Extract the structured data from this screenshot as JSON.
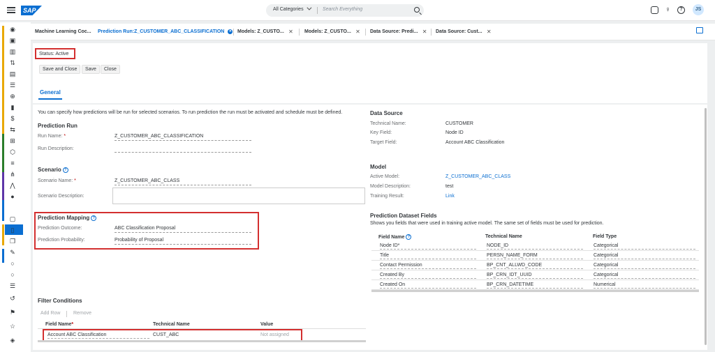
{
  "shell": {
    "search_category": "All Categories",
    "search_placeholder": "Search Everything",
    "avatar": "JS",
    "logo": "SAP"
  },
  "tabs": [
    {
      "label": "Machine Learning Coc..."
    },
    {
      "label": "Prediction Run:Z_CUSTOMER_ABC_CLASSIFICATION"
    },
    {
      "label": "Models: Z_CUSTO..."
    },
    {
      "label": "Models: Z_CUSTO..."
    },
    {
      "label": "Data Source: Predi..."
    },
    {
      "label": "Data Source: Cust..."
    }
  ],
  "header": {
    "status_label": "Status:",
    "status_value": "Active",
    "save_close": "Save and Close",
    "save": "Save",
    "close": "Close",
    "tab_general": "General"
  },
  "intro": "You can specify how predictions will be run for selected scenarios. To run prediction the run must be activated and schedule must be defined.",
  "prediction_run": {
    "title": "Prediction Run",
    "run_name_label": "Run Name:",
    "run_name": "Z_CUSTOMER_ABC_CLASSIFICATION",
    "run_desc_label": "Run Description:"
  },
  "scenario": {
    "title": "Scenario",
    "name_label": "Scenario Name:",
    "name": "Z_CUSTOMER_ABC_CLASS",
    "desc_label": "Scenario Description:"
  },
  "mapping": {
    "title": "Prediction Mapping",
    "outcome_label": "Prediction Outcome:",
    "outcome": "ABC Classification Proposal",
    "prob_label": "Prediction Probability:",
    "prob": "Probability of Proposal"
  },
  "filter": {
    "title": "Filter Conditions",
    "add_row": "Add Row",
    "remove": "Remove",
    "col_field": "Field Name",
    "col_tech": "Technical Name",
    "col_value": "Value",
    "row_field": "Account ABC Classification",
    "row_tech": "CUST_ABC",
    "row_value": "Not assigned"
  },
  "data_source": {
    "title": "Data Source",
    "tech_label": "Technical Name:",
    "tech": "CUSTOMER",
    "key_label": "Key Field:",
    "key": "Node ID",
    "target_label": "Target Field:",
    "target": "Account ABC Classification"
  },
  "model": {
    "title": "Model",
    "active_label": "Active Model:",
    "active": "Z_CUSTOMER_ABC_CLASS",
    "desc_label": "Model Description:",
    "desc": "test",
    "result_label": "Training Result:",
    "result": "Link"
  },
  "dataset": {
    "title": "Prediction Dataset Fields",
    "subtitle": "Shows you fields that were used in training active model. The same set of fields must be used for prediction.",
    "col_field": "Field Name",
    "col_tech": "Technical Name",
    "col_type": "Field Type",
    "rows": [
      {
        "field": "Node ID*",
        "tech": "NODE_ID",
        "type": "Categorical"
      },
      {
        "field": "Title",
        "tech": "PERSN_NAME_FORM",
        "type": "Categorical"
      },
      {
        "field": "Contact Permission",
        "tech": "BP_CNT_ALLWD_CODE",
        "type": "Categorical"
      },
      {
        "field": "Created By",
        "tech": "BP_CRN_IDT_UUID",
        "type": "Categorical"
      },
      {
        "field": "Created On",
        "tech": "BP_CRN_DATETIME",
        "type": "Numerical"
      }
    ]
  }
}
